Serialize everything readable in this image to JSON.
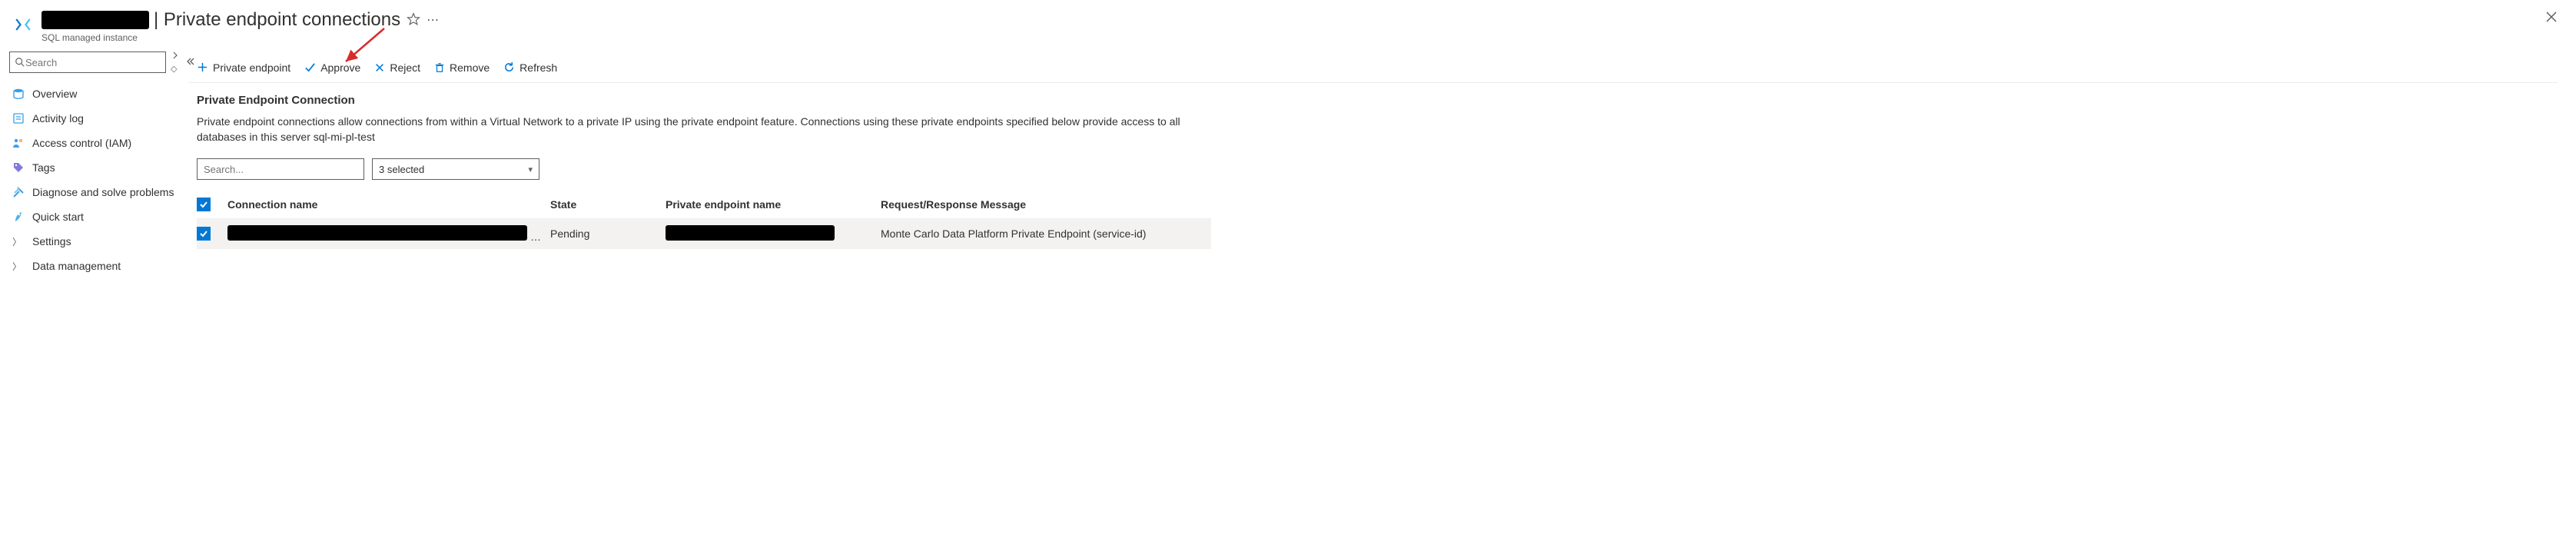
{
  "header": {
    "page_title_suffix": "| Private endpoint connections",
    "resource_type": "SQL managed instance"
  },
  "sidebar": {
    "search_placeholder": "Search",
    "items": [
      {
        "label": "Overview",
        "icon": "overview"
      },
      {
        "label": "Activity log",
        "icon": "activity-log"
      },
      {
        "label": "Access control (IAM)",
        "icon": "iam"
      },
      {
        "label": "Tags",
        "icon": "tags"
      },
      {
        "label": "Diagnose and solve problems",
        "icon": "diagnose"
      },
      {
        "label": "Quick start",
        "icon": "quickstart"
      },
      {
        "label": "Settings",
        "icon": "chevron"
      },
      {
        "label": "Data management",
        "icon": "chevron"
      }
    ]
  },
  "toolbar": {
    "private_endpoint": "Private endpoint",
    "approve": "Approve",
    "reject": "Reject",
    "remove": "Remove",
    "refresh": "Refresh"
  },
  "content": {
    "section_title": "Private Endpoint Connection",
    "description": "Private endpoint connections allow connections from within a Virtual Network to a private IP using the private endpoint feature. Connections using these private endpoints specified below provide access to all databases in this server sql-mi-pl-test",
    "search_placeholder": "Search...",
    "filter_selected": "3 selected"
  },
  "table": {
    "columns": {
      "connection_name": "Connection name",
      "state": "State",
      "private_endpoint_name": "Private endpoint name",
      "message": "Request/Response Message"
    },
    "rows": [
      {
        "state": "Pending",
        "message": "Monte Carlo Data Platform Private Endpoint (service-id)"
      }
    ]
  }
}
